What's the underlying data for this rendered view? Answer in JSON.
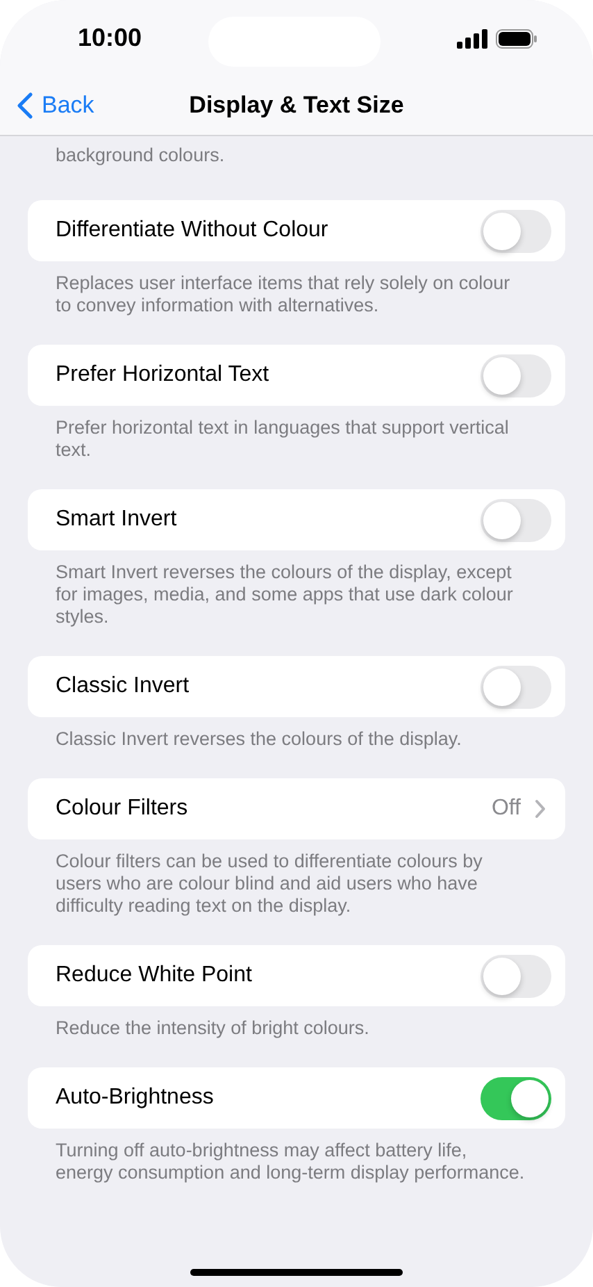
{
  "status_bar": {
    "time": "10:00"
  },
  "nav": {
    "back": "Back",
    "title": "Display & Text Size"
  },
  "top_footer": "background colours.",
  "settings": [
    {
      "kind": "toggle",
      "label": "Differentiate Without Colour",
      "on": false,
      "footer": "Replaces user interface items that rely solely on colour to convey information with alternatives."
    },
    {
      "kind": "toggle",
      "label": "Prefer Horizontal Text",
      "on": false,
      "footer": "Prefer horizontal text in languages that support vertical text."
    },
    {
      "kind": "toggle",
      "label": "Smart Invert",
      "on": false,
      "footer": "Smart Invert reverses the colours of the display, except for images, media, and some apps that use dark colour styles."
    },
    {
      "kind": "toggle",
      "label": "Classic Invert",
      "on": false,
      "footer": "Classic Invert reverses the colours of the display."
    },
    {
      "kind": "disclosure",
      "label": "Colour Filters",
      "value": "Off",
      "footer": "Colour filters can be used to differentiate colours by users who are colour blind and aid users who have difficulty reading text on the display."
    },
    {
      "kind": "toggle",
      "label": "Reduce White Point",
      "on": false,
      "footer": "Reduce the intensity of bright colours."
    },
    {
      "kind": "toggle",
      "label": "Auto-Brightness",
      "on": true,
      "footer": "Turning off auto-brightness may affect battery life, energy consumption and long-term display performance."
    }
  ]
}
